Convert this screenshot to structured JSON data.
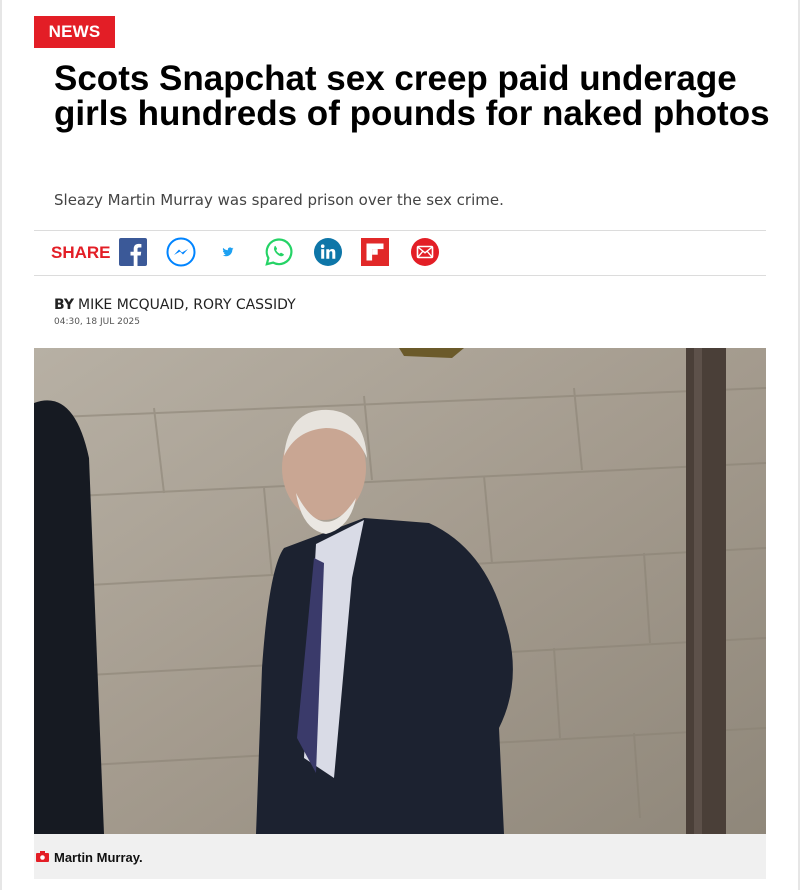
{
  "section_badge": "NEWS",
  "headline": "Scots Snapchat sex creep paid underage girls hundreds of pounds for naked photos",
  "standfirst": "Sleazy Martin Murray was spared prison over the sex crime.",
  "share": {
    "label": "SHARE",
    "icons": [
      "facebook-icon",
      "messenger-icon",
      "twitter-icon",
      "whatsapp-icon",
      "linkedin-icon",
      "flipboard-icon",
      "email-icon"
    ]
  },
  "byline": {
    "prefix": "BY",
    "authors": "MIKE MCQUAID, RORY CASSIDY",
    "timestamp": "04:30, 18 JUL 2025"
  },
  "image": {
    "caption": "Martin Murray."
  },
  "colors": {
    "brand_red": "#e31e26",
    "facebook": "#3b5998",
    "messenger": "#0084ff",
    "twitter": "#1da1f2",
    "whatsapp": "#25d366",
    "linkedin": "#0e76a8",
    "flipboard": "#e12828",
    "email": "#e31e26"
  }
}
